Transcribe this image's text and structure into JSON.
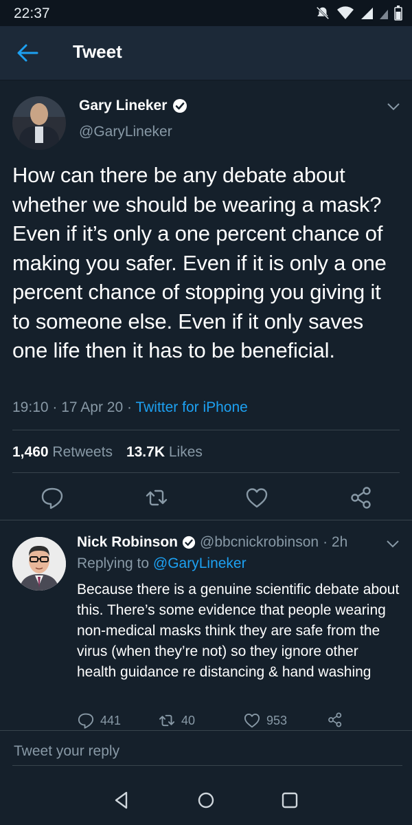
{
  "status_bar": {
    "time": "22:37",
    "icons": [
      "notifications-off-icon",
      "wifi-icon",
      "signal-icon",
      "battery-icon"
    ]
  },
  "header": {
    "title": "Tweet",
    "back_icon": "arrow-left-icon"
  },
  "tweet": {
    "author": {
      "name": "Gary Lineker",
      "handle": "@GaryLineker",
      "verified": true
    },
    "text": "How can there be any debate about whether we should be wearing a mask? Even if it’s only a one percent chance of making you safer. Even if it is only a one percent chance of stopping you giving it to someone else. Even if it only saves one life then it has to be beneficial.",
    "time": "19:10",
    "date": "17 Apr 20",
    "source": "Twitter for iPhone",
    "retweets_count": "1,460",
    "retweets_label": "Retweets",
    "likes_count": "13.7K",
    "likes_label": "Likes",
    "actions": [
      "reply-icon",
      "retweet-icon",
      "like-icon",
      "share-icon"
    ]
  },
  "reply": {
    "author": {
      "name": "Nick Robinson",
      "handle": "@bbcnickrobinson",
      "verified": true
    },
    "age": "· 2h",
    "replying_prefix": "Replying to",
    "replying_to": "@GaryLineker",
    "text": "Because there is a genuine scientific debate about this. There’s some evidence that people wearing non-medical masks think they are safe from the virus (when they’re not) so they ignore other health guidance re distancing & hand washing",
    "replies": "441",
    "retweets": "40",
    "likes": "953"
  },
  "reply_box": {
    "placeholder": "Tweet your reply"
  },
  "colors": {
    "background": "#15202b",
    "header": "#1c2938",
    "accent": "#1da1f2",
    "secondary_text": "#8899a6",
    "divider": "#38444d"
  }
}
